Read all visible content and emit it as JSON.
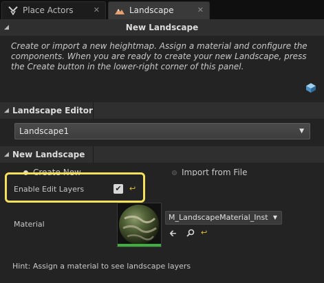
{
  "tabs": [
    {
      "label": "Place Actors",
      "icon": "place-actors-icon",
      "close": "✕"
    },
    {
      "label": "Landscape",
      "icon": "landscape-mountain-icon",
      "close": "✕"
    }
  ],
  "new_landscape_header": {
    "title": "New Landscape"
  },
  "description": "Create or import a new heightmap. Assign a material and configure the components. When you are ready to create your new Landscape, press the Create button in the lower-right corner of this panel.",
  "landscape_editor": {
    "title": "Landscape Editor",
    "selected": "Landscape1"
  },
  "new_landscape_section": {
    "title": "New Landscape",
    "create_new_label": "Create New",
    "import_label": "Import from File"
  },
  "edit_layers": {
    "label": "Enable Edit Layers",
    "checked": true
  },
  "material": {
    "label": "Material",
    "value": "M_LandscapeMaterial_Inst"
  },
  "hint": "Hint: Assign a material to see landscape layers",
  "colors": {
    "highlight": "#f5e15a",
    "reset_arrow": "#e6c229"
  }
}
